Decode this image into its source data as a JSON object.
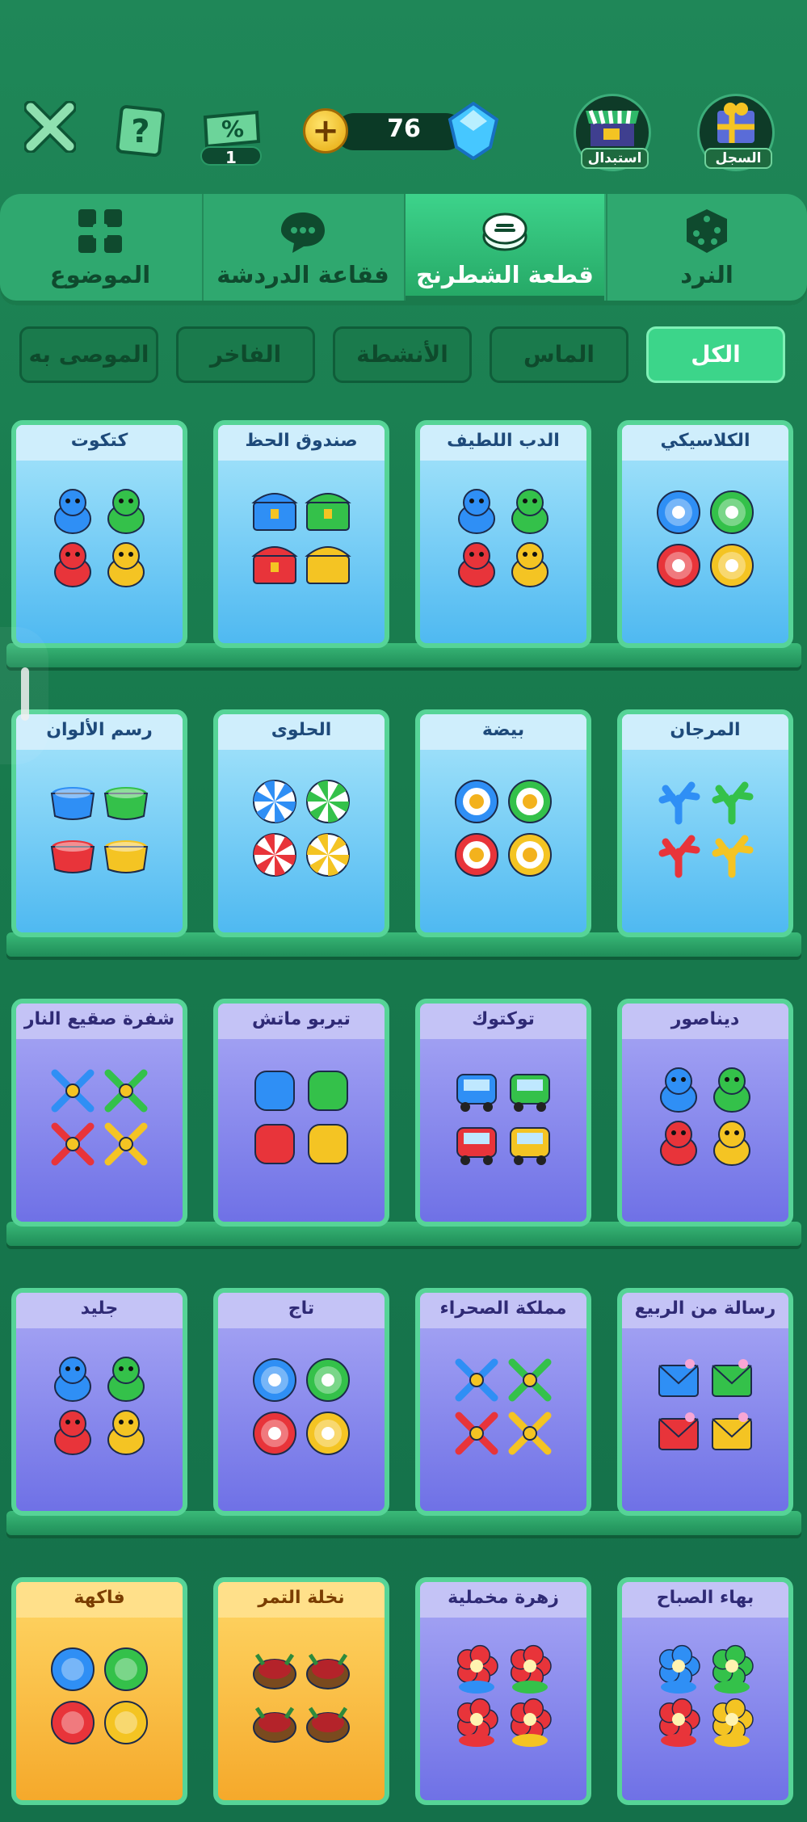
{
  "topbar": {
    "coins": "76",
    "voucher_count": "1",
    "exchange_label": "استبدال",
    "record_label": "السجل"
  },
  "tabs": [
    {
      "label": "الموضوع",
      "icon": "grid-icon"
    },
    {
      "label": "فقاعة الدردشة",
      "icon": "chat-bubble-icon"
    },
    {
      "label": "قطعة الشطرنج",
      "icon": "token-icon",
      "active": true
    },
    {
      "label": "النرد",
      "icon": "dice-icon"
    }
  ],
  "filters": [
    {
      "label": "الموصى به"
    },
    {
      "label": "الفاخر"
    },
    {
      "label": "الأنشطة"
    },
    {
      "label": "الماس"
    },
    {
      "label": "الكل",
      "active": true
    }
  ],
  "rows": [
    [
      {
        "title": "كتكوت",
        "style": "blue",
        "art": "chicks"
      },
      {
        "title": "صندوق الحظ",
        "style": "blue",
        "art": "chests"
      },
      {
        "title": "الدب اللطيف",
        "style": "blue",
        "art": "bears"
      },
      {
        "title": "الكلاسيكي",
        "style": "blue",
        "art": "classic"
      }
    ],
    [
      {
        "title": "رسم الألوان",
        "style": "blue",
        "art": "paint"
      },
      {
        "title": "الحلوى",
        "style": "blue",
        "art": "candy"
      },
      {
        "title": "بيضة",
        "style": "blue",
        "art": "egg"
      },
      {
        "title": "المرجان",
        "style": "blue",
        "art": "coral"
      }
    ],
    [
      {
        "title": "شفرة صقيع النار",
        "style": "purple",
        "art": "swords"
      },
      {
        "title": "تيربو ماتش",
        "style": "purple",
        "art": "match"
      },
      {
        "title": "توكتوك",
        "style": "purple",
        "art": "tuktuk"
      },
      {
        "title": "ديناصور",
        "style": "purple",
        "art": "dino"
      }
    ],
    [
      {
        "title": "جليد",
        "style": "purple",
        "art": "snowman"
      },
      {
        "title": "تاج",
        "style": "purple",
        "art": "crown"
      },
      {
        "title": "مملكة الصحراء",
        "style": "purple",
        "art": "bow"
      },
      {
        "title": "رسالة من الربيع",
        "style": "purple",
        "art": "envelope"
      }
    ],
    [
      {
        "title": "فاكهة",
        "style": "yellow",
        "art": "fruit"
      },
      {
        "title": "نخلة التمر",
        "style": "yellow",
        "art": "dates"
      },
      {
        "title": "زهرة مخملية",
        "style": "purple",
        "art": "rose"
      },
      {
        "title": "بهاء الصباح",
        "style": "purple",
        "art": "flower"
      }
    ]
  ],
  "palette": {
    "blue": "#2f8ff5",
    "green": "#34c14a",
    "red": "#e8343a",
    "yellow": "#f4c423"
  }
}
